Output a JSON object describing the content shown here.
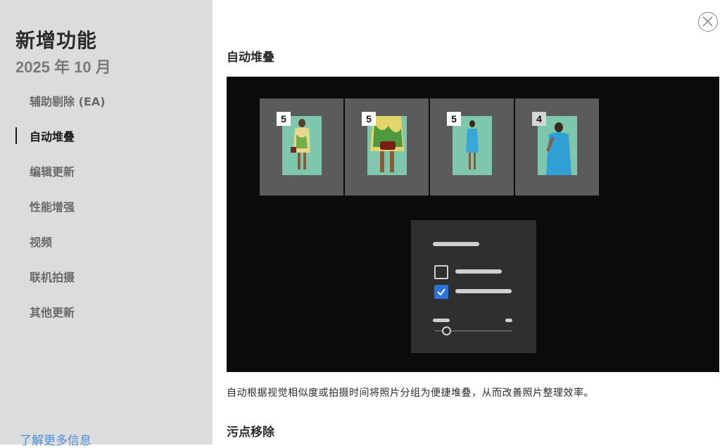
{
  "sidebar": {
    "title": "新增功能",
    "date": "2025 年 10 月",
    "items": [
      {
        "label": "辅助剔除 (EA)",
        "active": false
      },
      {
        "label": "自动堆叠",
        "active": true
      },
      {
        "label": "编辑更新",
        "active": false
      },
      {
        "label": "性能增强",
        "active": false
      },
      {
        "label": "视频",
        "active": false
      },
      {
        "label": "联机拍摄",
        "active": false
      },
      {
        "label": "其他更新",
        "active": false
      }
    ],
    "learn_more": "了解更多信息"
  },
  "content": {
    "section1": {
      "title": "自动堆叠",
      "stacks": [
        {
          "count": "5"
        },
        {
          "count": "5"
        },
        {
          "count": "5"
        },
        {
          "count": "4"
        }
      ],
      "description": "自动根据视觉相似度或拍摄时间将照片分组为便捷堆叠，从而改善照片整理效率。"
    },
    "section2": {
      "title": "污点移除"
    }
  },
  "icons": {
    "close": "close-icon",
    "checkbox_checked": "checkmark-icon"
  },
  "colors": {
    "accent": "#2b72d9",
    "link": "#4a90d9",
    "sidebar_bg": "#dcdcdc",
    "photo_bg": "#7fc7ac"
  }
}
